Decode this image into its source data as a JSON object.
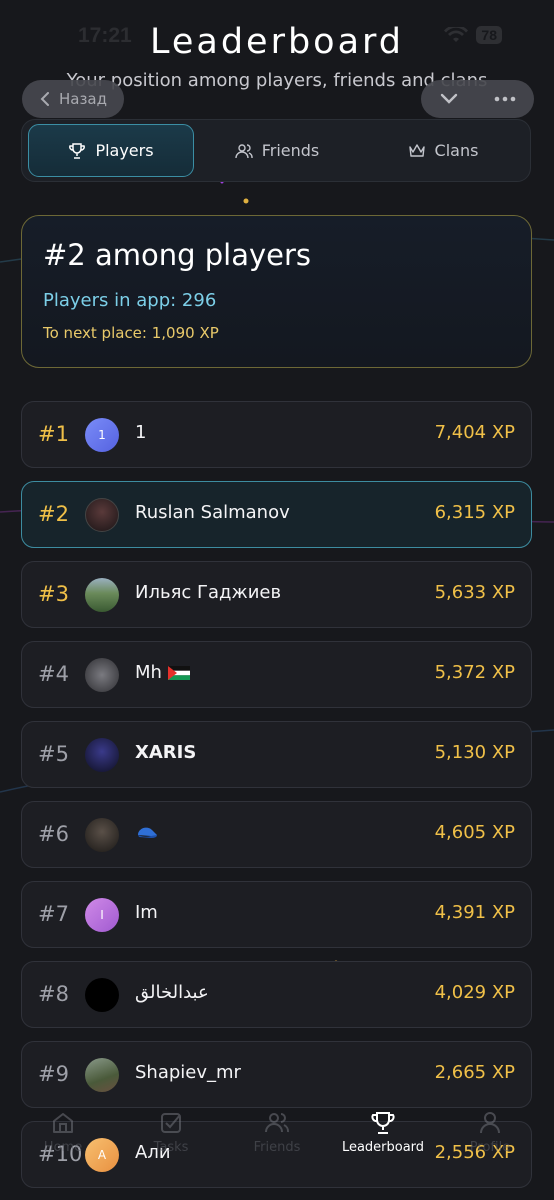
{
  "status_bar": {
    "time": "17:21",
    "battery": "78"
  },
  "header": {
    "title": "Leaderboard",
    "subtitle": "Your position among players, friends and clans",
    "back_label": "Назад"
  },
  "tabs": [
    {
      "label": "Players",
      "icon": "trophy-icon",
      "active": true
    },
    {
      "label": "Friends",
      "icon": "users-icon",
      "active": false
    },
    {
      "label": "Clans",
      "icon": "crown-icon",
      "active": false
    }
  ],
  "position_card": {
    "title": "#2 among players",
    "players_count": "Players in app: 296",
    "next_place": "To next place: 1,090 XP"
  },
  "leaderboard": [
    {
      "rank": "#1",
      "name": "1",
      "xp": "7,404 XP",
      "avatar_letter": "1",
      "avatar_color": "#6a7cf0"
    },
    {
      "rank": "#2",
      "name": "Ruslan Salmanov",
      "xp": "6,315 XP",
      "avatar_letter": "",
      "avatar_color": "#2a2224"
    },
    {
      "rank": "#3",
      "name": "Ильяс Гаджиев",
      "xp": "5,633 XP",
      "avatar_letter": "",
      "avatar_color": "#4f6a4a"
    },
    {
      "rank": "#4",
      "name": "Mh",
      "xp": "5,372 XP",
      "avatar_letter": "",
      "avatar_color": "#4a4a4e"
    },
    {
      "rank": "#5",
      "name": "XARIS",
      "xp": "5,130 XP",
      "avatar_letter": "",
      "avatar_color": "#1f2240"
    },
    {
      "rank": "#6",
      "name": "",
      "xp": "4,605 XP",
      "avatar_letter": "",
      "avatar_color": "#2c2a28"
    },
    {
      "rank": "#7",
      "name": "Im",
      "xp": "4,391 XP",
      "avatar_letter": "I",
      "avatar_color": "#c07ae0"
    },
    {
      "rank": "#8",
      "name": "عبدالخالق",
      "xp": "4,029 XP",
      "avatar_letter": "",
      "avatar_color": "#000000"
    },
    {
      "rank": "#9",
      "name": "Shapiev_mr",
      "xp": "2,665 XP",
      "avatar_letter": "",
      "avatar_color": "#5a6a50"
    },
    {
      "rank": "#10",
      "name": "Али",
      "xp": "2,556 XP",
      "avatar_letter": "A",
      "avatar_color": "#f0a850"
    }
  ],
  "bottom_nav": [
    {
      "label": "Home",
      "icon": "home-icon",
      "active": false
    },
    {
      "label": "Tasks",
      "icon": "tasks-icon",
      "active": false
    },
    {
      "label": "Friends",
      "icon": "friends-icon",
      "active": false
    },
    {
      "label": "Leaderboard",
      "icon": "trophy-icon",
      "active": true
    },
    {
      "label": "Profile",
      "icon": "profile-icon",
      "active": false
    }
  ],
  "colors": {
    "gold": "#f0c048",
    "accent": "#3d8ca0",
    "cyan_text": "#7ccfe8"
  }
}
